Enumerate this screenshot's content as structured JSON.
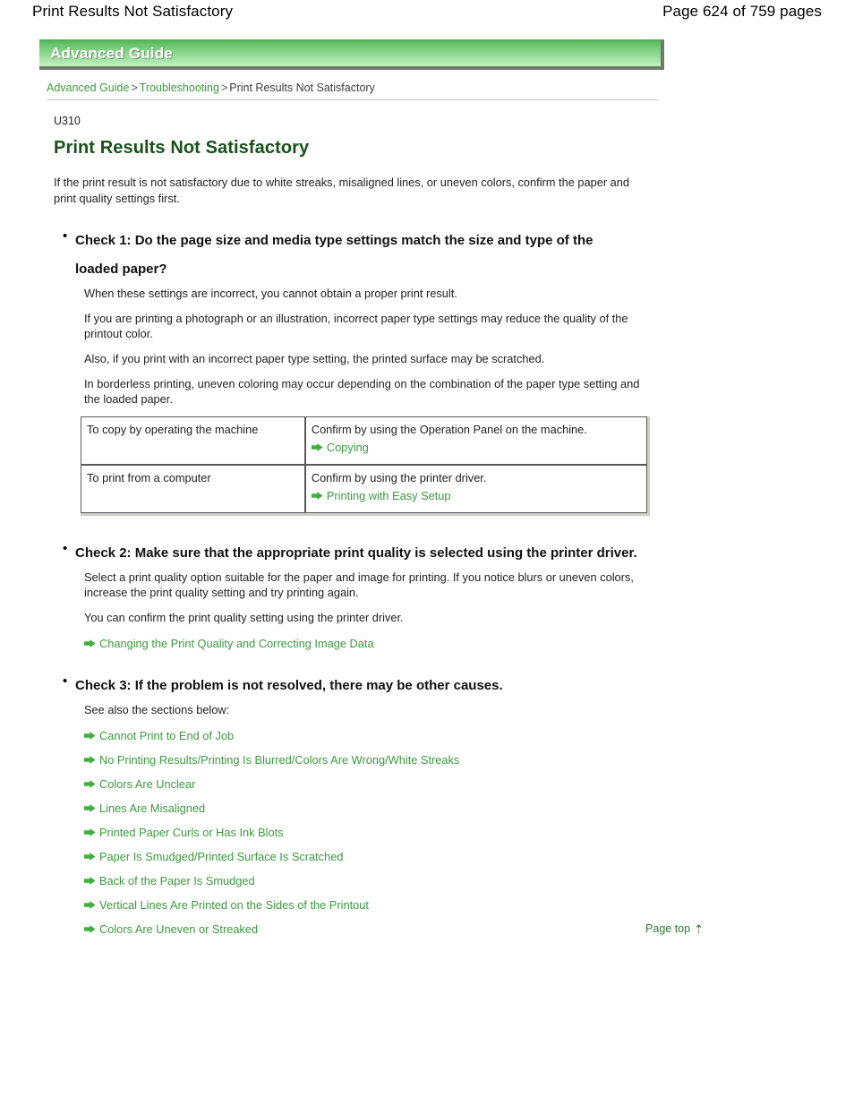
{
  "page_header": {
    "title": "Print Results Not Satisfactory",
    "page_label": "Page 624 of 759 pages"
  },
  "banner": {
    "label": "Advanced Guide",
    "color": "#68c46d"
  },
  "breadcrumb": {
    "items": [
      {
        "label": "Advanced Guide",
        "type": "link"
      },
      {
        "label": "Troubleshooting",
        "type": "link"
      },
      {
        "label": "Print Results Not Satisfactory",
        "type": "current"
      }
    ],
    "separator": ">"
  },
  "doc": {
    "code": "U310",
    "title": "Print Results Not Satisfactory",
    "title_color": "#17521a",
    "intro": "If the print result is not satisfactory due to white streaks, misaligned lines, or uneven colors, confirm the paper and print quality settings first."
  },
  "checks": [
    {
      "bullet": "•",
      "heading": "Check 1: Do the page size and media type settings match the size and type of the loaded paper?",
      "paragraphs": [
        "When these settings are incorrect, you cannot obtain a proper print result.",
        "If you are printing a photograph or an illustration, incorrect paper type settings may reduce the quality of the printout color.",
        "Also, if you print with an incorrect paper type setting, the printed surface may be scratched.",
        "In borderless printing, uneven coloring may occur depending on the combination of the paper type setting and the loaded paper."
      ]
    },
    {
      "bullet": "•",
      "heading": "Check 2: Make sure that the appropriate print quality is selected using the printer driver.",
      "paragraphs": [
        "Select a print quality option suitable for the paper and image for printing. If you notice blurs or uneven colors, increase the print quality setting and try printing again.",
        "You can confirm the print quality setting using the printer driver."
      ],
      "link": "Changing the Print Quality and Correcting Image Data"
    },
    {
      "bullet": "•",
      "heading": "Check 3: If the problem is not resolved, there may be other causes.",
      "paragraphs": [
        "See also the sections below:"
      ]
    }
  ],
  "table": {
    "rows": [
      {
        "left": "To copy by operating the machine",
        "right_text": "Confirm by using the Operation Panel on the machine.",
        "right_link": "Copying"
      },
      {
        "left": "To print from a computer",
        "right_text": "Confirm by using the printer driver.",
        "right_link": "Printing with Easy Setup"
      }
    ]
  },
  "related_links": [
    "Cannot Print to End of Job",
    "No Printing Results/Printing Is Blurred/Colors Are Wrong/White Streaks",
    "Colors Are Unclear",
    "Lines Are Misaligned",
    "Printed Paper Curls or Has Ink Blots",
    "Paper Is Smudged/Printed Surface Is Scratched",
    "Back of the Paper Is Smudged",
    "Vertical Lines Are Printed on the Sides of the Printout",
    "Colors Are Uneven or Streaked"
  ],
  "footer": {
    "page_top_label": "Page top",
    "page_top_icon": "arrow-up-icon"
  },
  "icons": {
    "arrow_right": "arrow-right-icon",
    "link_color": "#3a9b3e"
  }
}
